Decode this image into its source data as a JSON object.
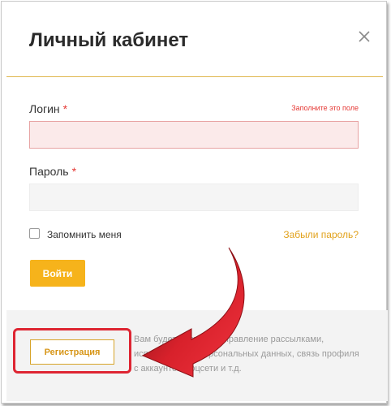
{
  "dialog": {
    "title": "Личный кабинет",
    "close_icon": "close-icon"
  },
  "form": {
    "login": {
      "label": "Логин",
      "required_mark": "*",
      "error": "Заполните это поле",
      "value": ""
    },
    "password": {
      "label": "Пароль",
      "required_mark": "*",
      "value": ""
    },
    "remember": {
      "label": "Запомнить меня",
      "checked": false
    },
    "forgot_link": "Забыли пароль?",
    "submit_label": "Войти"
  },
  "footer": {
    "register_label": "Регистрация",
    "text": "Вам будет доступно управление рассылками, использование персональных данных, связь профиля с аккаунтом соцсети и т.д."
  },
  "annotation": {
    "arrow_icon": "red-arrow-icon",
    "highlight_color": "#de2532"
  },
  "colors": {
    "accent": "#f6b31b",
    "error": "#e53935",
    "divider": "#e0b74d"
  }
}
